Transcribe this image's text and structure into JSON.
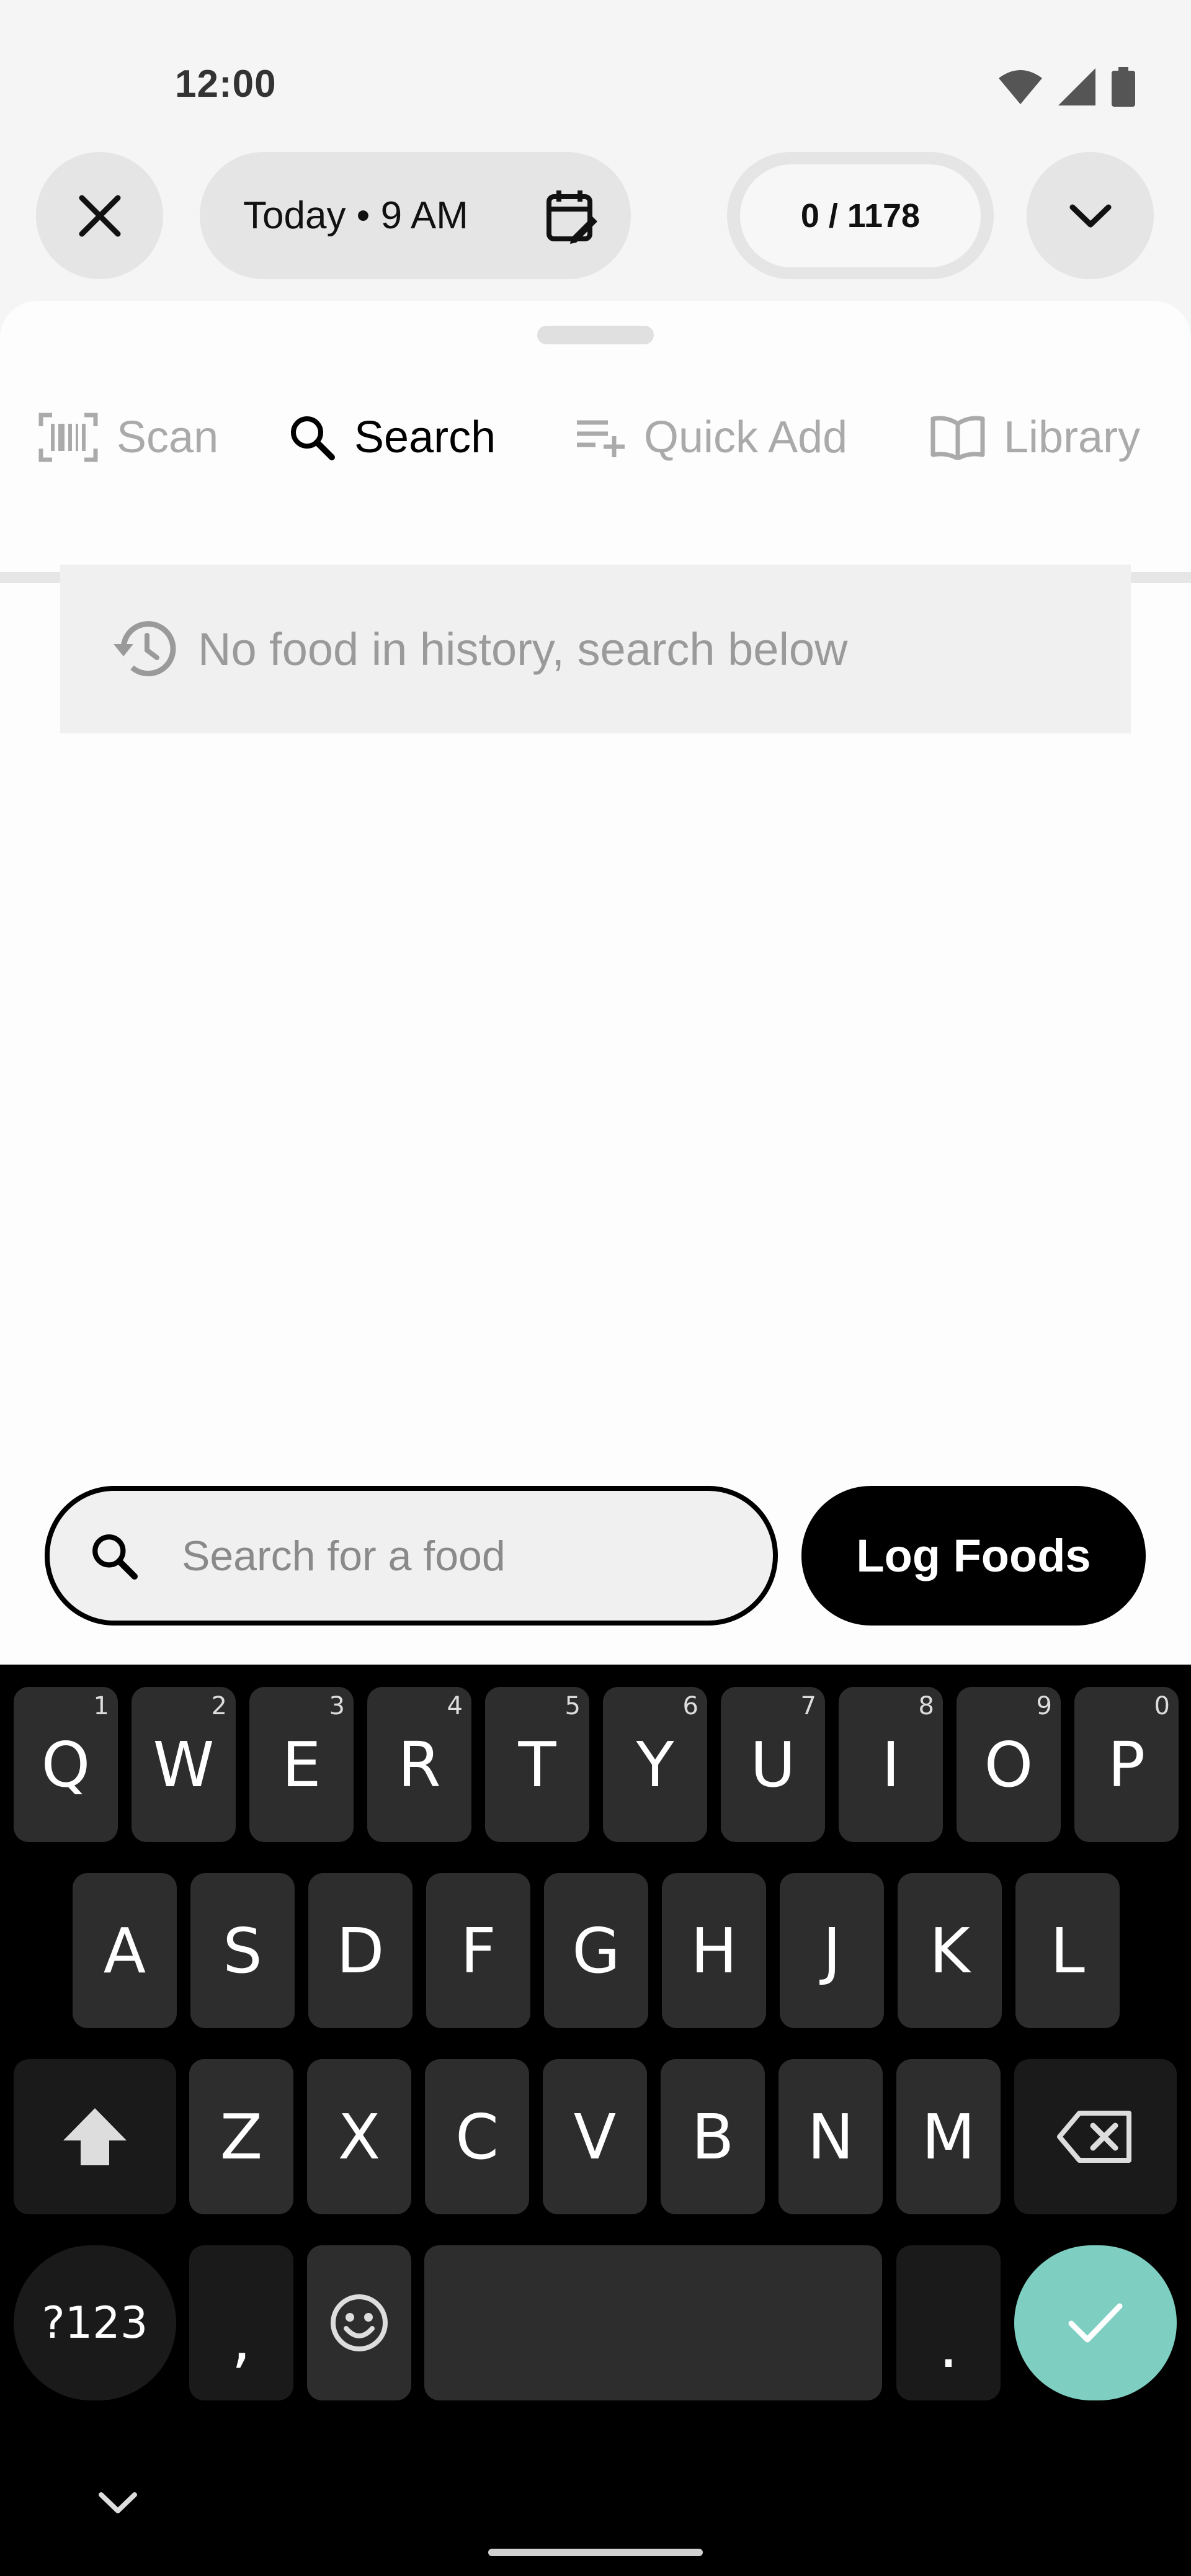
{
  "status_bar": {
    "time": "12:00",
    "icons": [
      "wifi-icon",
      "signal-icon",
      "battery-icon"
    ]
  },
  "top_controls": {
    "close_icon": "close-icon",
    "date_label": "Today • 9 AM",
    "calendar_icon": "calendar-edit-icon",
    "count_label": "0 / 1178",
    "chevron_icon": "chevron-down-icon"
  },
  "tabs": [
    {
      "label": "Scan",
      "icon": "barcode-icon",
      "active": false
    },
    {
      "label": "Search",
      "icon": "search-icon",
      "active": true
    },
    {
      "label": "Quick Add",
      "icon": "playlist-add-icon",
      "active": false
    },
    {
      "label": "Library",
      "icon": "book-icon",
      "active": false
    }
  ],
  "history": {
    "message": "No food in history, search below",
    "icon": "history-icon"
  },
  "search": {
    "placeholder": "Search for a food",
    "value": ""
  },
  "log_button": {
    "label": "Log Foods"
  },
  "keyboard": {
    "row1": [
      {
        "key": "Q",
        "hint": "1"
      },
      {
        "key": "W",
        "hint": "2"
      },
      {
        "key": "E",
        "hint": "3"
      },
      {
        "key": "R",
        "hint": "4"
      },
      {
        "key": "T",
        "hint": "5"
      },
      {
        "key": "Y",
        "hint": "6"
      },
      {
        "key": "U",
        "hint": "7"
      },
      {
        "key": "I",
        "hint": "8"
      },
      {
        "key": "O",
        "hint": "9"
      },
      {
        "key": "P",
        "hint": "0"
      }
    ],
    "row2": [
      "A",
      "S",
      "D",
      "F",
      "G",
      "H",
      "J",
      "K",
      "L"
    ],
    "row3": [
      "Z",
      "X",
      "C",
      "V",
      "B",
      "N",
      "M"
    ],
    "symbols_label": "?123",
    "comma": ",",
    "period": ".",
    "enter_color": "#7ecfc2"
  }
}
